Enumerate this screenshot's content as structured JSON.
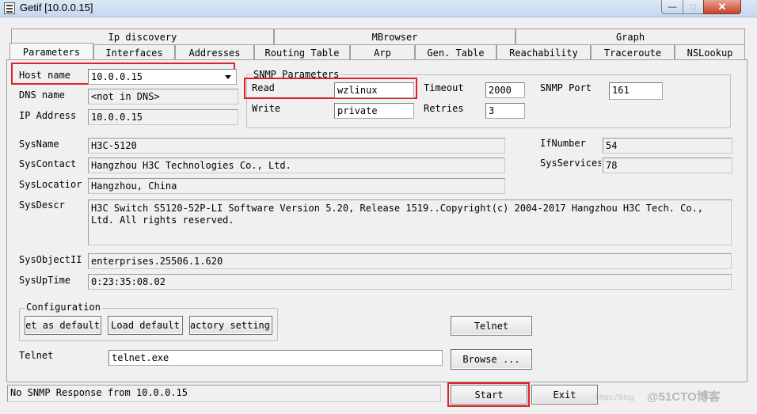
{
  "window": {
    "title": "Getif [10.0.0.15]",
    "minimize": "—",
    "maximize": "□",
    "close": "✕"
  },
  "tabs": {
    "row1": [
      "Ip discovery",
      "MBrowser",
      "Graph"
    ],
    "row2": [
      "Parameters",
      "Interfaces",
      "Addresses",
      "Routing Table",
      "Arp",
      "Gen. Table",
      "Reachability",
      "Traceroute",
      "NSLookup"
    ]
  },
  "parameters": {
    "host_name_label": "Host name",
    "host_name_value": "10.0.0.15",
    "dns_name_label": "DNS name",
    "dns_name_value": "<not in DNS>",
    "ip_address_label": "IP Address",
    "ip_address_value": "10.0.0.15"
  },
  "snmp": {
    "group_title": "SNMP Parameters",
    "read_label": "Read",
    "read_value": "wzlinux",
    "write_label": "Write",
    "write_value": "private",
    "timeout_label": "Timeout",
    "timeout_value": "2000",
    "retries_label": "Retries",
    "retries_value": "3",
    "port_label": "SNMP Port",
    "port_value": "161"
  },
  "system": {
    "sysname_label": "SysName",
    "sysname_value": "H3C-5120",
    "syscontact_label": "SysContact",
    "syscontact_value": "Hangzhou H3C Technologies Co., Ltd.",
    "syslocation_label": "SysLocatior",
    "syslocation_value": "Hangzhou, China",
    "sysdescr_label": "SysDescr",
    "sysdescr_value": "H3C Switch S5120-52P-LI Software Version 5.20, Release 1519..Copyright(c) 2004-2017 Hangzhou H3C Tech. Co., Ltd. All rights reserved.",
    "sysobjectid_label": "SysObjectII",
    "sysobjectid_value": "enterprises.25506.1.620",
    "sysuptime_label": "SysUpTime",
    "sysuptime_value": "0:23:35:08.02",
    "ifnumber_label": "IfNumber",
    "ifnumber_value": "54",
    "sysservices_label": "SysServices",
    "sysservices_value": "78"
  },
  "configuration": {
    "group_title": "Configuration",
    "set_default": "Set as default",
    "load_default": "Load default",
    "factory_setting": "Factory setting"
  },
  "telnet": {
    "button": "Telnet",
    "label": "Telnet",
    "path_value": "telnet.exe",
    "browse": "Browse ..."
  },
  "footer": {
    "status": "No SNMP Response from 10.0.0.15",
    "start": "Start",
    "exit": "Exit",
    "watermark": "@51CTO博客",
    "watermark_small": "https://blog"
  },
  "colors": {
    "highlight": "#e0202a",
    "titlebar": "#c4d8ee"
  }
}
